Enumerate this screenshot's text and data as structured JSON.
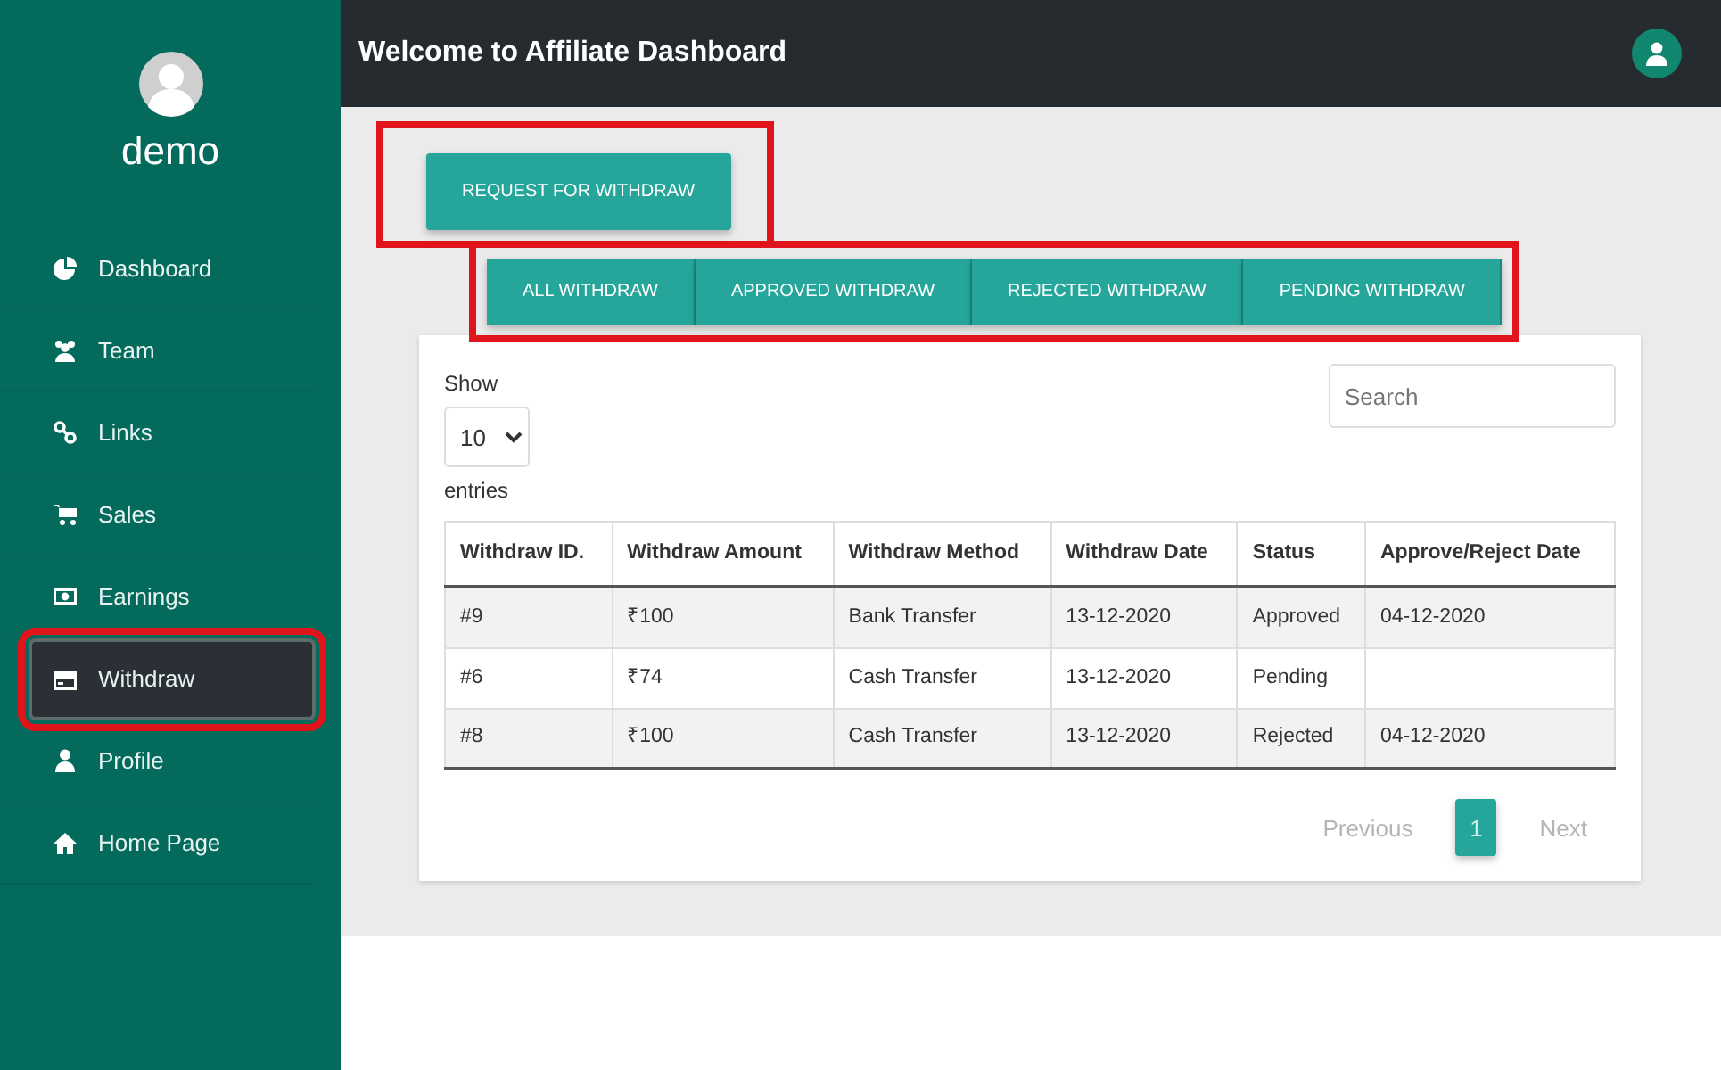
{
  "sidebar": {
    "user_name": "demo",
    "items": [
      {
        "label": "Dashboard",
        "selected": false,
        "highlighted": false
      },
      {
        "label": "Team",
        "selected": false,
        "highlighted": false
      },
      {
        "label": "Links",
        "selected": false,
        "highlighted": false
      },
      {
        "label": "Sales",
        "selected": false,
        "highlighted": false
      },
      {
        "label": "Earnings",
        "selected": false,
        "highlighted": false
      },
      {
        "label": "Withdraw",
        "selected": true,
        "highlighted": true
      },
      {
        "label": "Profile",
        "selected": false,
        "highlighted": false
      },
      {
        "label": "Home Page",
        "selected": false,
        "highlighted": false
      }
    ]
  },
  "header": {
    "title": "Welcome to Affiliate Dashboard"
  },
  "request_button": {
    "label": "REQUEST FOR WITHDRAW",
    "highlighted": true
  },
  "filter_tabs": {
    "highlighted": true,
    "items": [
      {
        "label": "ALL WITHDRAW"
      },
      {
        "label": "APPROVED WITHDRAW"
      },
      {
        "label": "REJECTED WITHDRAW"
      },
      {
        "label": "PENDING WITHDRAW"
      }
    ]
  },
  "table_controls": {
    "show_label": "Show",
    "page_size": "10",
    "entries_label": "entries",
    "search_placeholder": "Search"
  },
  "table": {
    "columns": [
      "Withdraw ID.",
      "Withdraw Amount",
      "Withdraw Method",
      "Withdraw Date",
      "Status",
      "Approve/Reject Date"
    ],
    "rows": [
      [
        "#9",
        "₹100",
        "Bank Transfer",
        "13-12-2020",
        "Approved",
        "04-12-2020"
      ],
      [
        "#6",
        "₹74",
        "Cash Transfer",
        "13-12-2020",
        "Pending",
        ""
      ],
      [
        "#8",
        "₹100",
        "Cash Transfer",
        "13-12-2020",
        "Rejected",
        "04-12-2020"
      ]
    ]
  },
  "pagination": {
    "previous": "Previous",
    "next": "Next",
    "pages": [
      {
        "label": "1",
        "selected": true
      }
    ]
  }
}
